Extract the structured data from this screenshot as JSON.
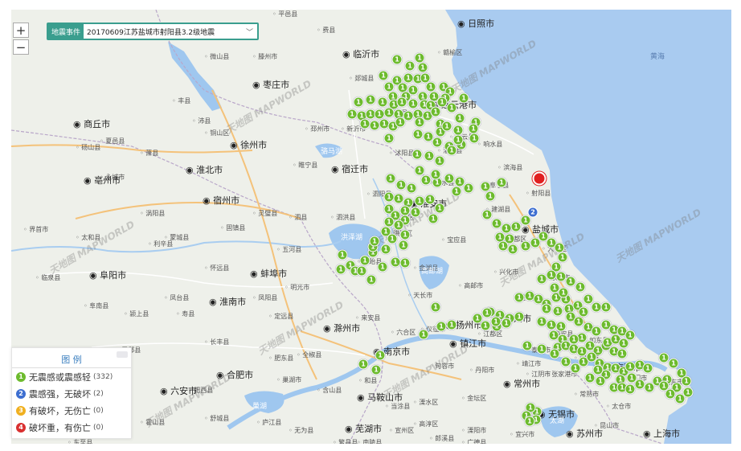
{
  "controls": {
    "zoom_in": "+",
    "zoom_out": "−"
  },
  "event_select": {
    "tag": "地震事件",
    "value": "20170609江苏盐城市射阳县3.2级地震",
    "caret": "﹀"
  },
  "legend": {
    "title": "图 例",
    "items": [
      {
        "label": "无震感或震感轻",
        "count": "(332)",
        "color": "#6dbb2e",
        "glyph": "1"
      },
      {
        "label": "震感强，无破坏",
        "count": "(2)",
        "color": "#3d6ed0",
        "glyph": "2"
      },
      {
        "label": "有破坏，无伤亡",
        "count": "(0)",
        "color": "#f0b020",
        "glyph": "3"
      },
      {
        "label": "破坏重，有伤亡",
        "count": "(0)",
        "color": "#d93030",
        "glyph": "4"
      }
    ]
  },
  "map": {
    "sea_color": "#a9cbf0",
    "land_color": "#eef0ea",
    "lake_color": "#9fc7ef",
    "marker_glyph": "1",
    "blue_glyph": "2",
    "cities": [
      "日照市",
      "临沂市",
      "枣庄市",
      "徐州市",
      "商丘市",
      "宿州市",
      "淮北市",
      "亳州市",
      "宿迁市",
      "连云港市",
      "淮安市",
      "盐城市",
      "蚌埠市",
      "阜阳市",
      "淮南市",
      "滁州市",
      "扬州市",
      "泰州市",
      "镇江市",
      "南京市",
      "合肥市",
      "马鞍山市",
      "常州市",
      "无锡市",
      "苏州市",
      "芜湖市",
      "南通市",
      "上海市",
      "六安市"
    ],
    "counties": [
      "平邑县",
      "费县",
      "郯城县",
      "沭阳县",
      "灌南县",
      "涟水县",
      "阜宁县",
      "建湖县",
      "宝应县",
      "高邮市",
      "兴化市",
      "东台市",
      "大丰区",
      "如东县",
      "海安县",
      "泗洪县",
      "泗阳县",
      "盱眙县",
      "天长市",
      "金湖县",
      "萧县",
      "砀山县",
      "永城市",
      "夏邑县",
      "灵璧县",
      "泗县",
      "五河县",
      "固镇县",
      "怀远县",
      "凤阳县",
      "明光市",
      "定远县",
      "全椒县",
      "来安县",
      "六合区",
      "江都区",
      "仪征市",
      "句容市",
      "丹阳市",
      "金坛区",
      "溧阳市",
      "宜兴市",
      "江阴市",
      "张家港市",
      "常熟市",
      "太仓市",
      "昆山市",
      "海门市",
      "启东市",
      "如皋市",
      "靖江市",
      "泰兴市",
      "姜堰区",
      "高淳区",
      "溧水区",
      "当涂县",
      "含山县",
      "和县",
      "巢湖市",
      "庐江县",
      "舒城县",
      "肥西县",
      "肥东县",
      "长丰县",
      "寿县",
      "凤台县",
      "利辛县",
      "蒙城县",
      "涡阳县",
      "太和县",
      "界首市",
      "临泉县",
      "阜南县",
      "颍上县",
      "霍邱县",
      "金寨县",
      "霍山县",
      "无为县",
      "繁昌县",
      "南陵县",
      "宣州区",
      "郎溪县",
      "广德县",
      "滕州市",
      "微山县",
      "邳州市",
      "新沂市",
      "睢宁县",
      "铜山区",
      "丰县",
      "沛县",
      "赣榆区",
      "东海县",
      "灌云县",
      "响水县",
      "滨海县",
      "射阳县",
      "洪泽区",
      "淮阴区",
      "盐都区",
      "东至县"
    ],
    "waters": [
      "洪泽湖",
      "骆马湖",
      "高邮湖",
      "巢湖",
      "太湖",
      "黄海"
    ],
    "watermark": "天地图 MAPWORLD",
    "epicenter_label": "射阳县"
  }
}
